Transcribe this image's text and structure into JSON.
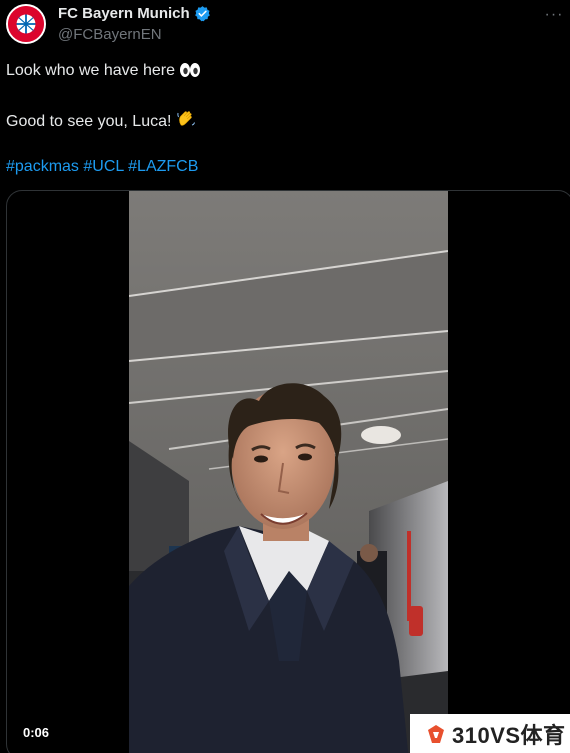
{
  "account": {
    "display_name": "FC Bayern Munich",
    "handle": "@FCBayernEN",
    "avatar_icon": "fc-bayern-logo",
    "verified_icon": "verified-badge-icon",
    "more_icon": "more-options-icon"
  },
  "tweet": {
    "line1": "Look who we have here",
    "line1_emoji": "eyes",
    "line2": "Good to see you, Luca!",
    "line2_emoji": "waving-hand",
    "hashtags": [
      "#packmas",
      "#UCL",
      "#LAZFCB"
    ]
  },
  "video": {
    "timestamp": "0:06"
  },
  "watermark": {
    "text": "310VS体育"
  },
  "colors": {
    "background": "#000000",
    "text": "#e7e9ea",
    "secondary": "#71767b",
    "link": "#1d9bf0",
    "verified": "#1d9bf0",
    "bayern_red": "#dc052d"
  }
}
